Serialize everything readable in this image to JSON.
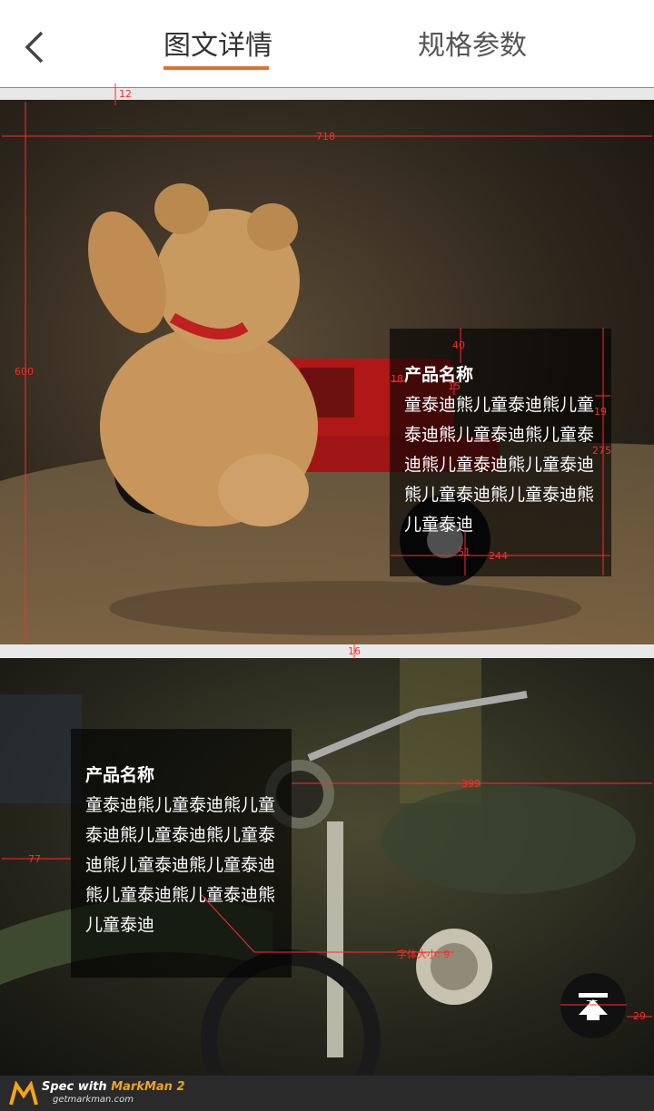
{
  "header": {
    "back_icon": "chevron-left-icon",
    "tabs": [
      {
        "label": "图文详情",
        "active": true
      },
      {
        "label": "规格参数",
        "active": false
      }
    ],
    "accent_color": "#e0702e"
  },
  "panel1": {
    "overlay": {
      "title": "产品名称",
      "body": "童泰迪熊儿童泰迪熊儿童泰迪熊儿童泰迪熊儿童泰迪熊儿童泰迪熊儿童泰迪熊儿童泰迪熊儿童泰迪熊儿童泰迪"
    }
  },
  "panel2": {
    "overlay": {
      "title": "产品名称",
      "body": "童泰迪熊儿童泰迪熊儿童泰迪熊儿童泰迪熊儿童泰迪熊儿童泰迪熊儿童泰迪熊儿童泰迪熊儿童泰迪熊儿童泰迪"
    }
  },
  "back_to_top_icon": "back-to-top-icon",
  "footer": {
    "spec_prefix": "Spec with ",
    "spec_brand": "MarkMan 2",
    "site": "getmarkman.com"
  },
  "annotations": {
    "gap_top": "12",
    "image_width": "718",
    "image_height": "600",
    "ov1_top": "40",
    "ov1_left": "18",
    "ov1_title_gap": "15",
    "ov1_right": "19",
    "ov1_height": "275",
    "ov1_bottom": "51",
    "ov1_width": "244",
    "gap_mid": "16",
    "ov2_right": "399",
    "ov2_left": "77",
    "font_size": "字体大小: 9",
    "btn_size": "75",
    "btn_right": "29"
  }
}
